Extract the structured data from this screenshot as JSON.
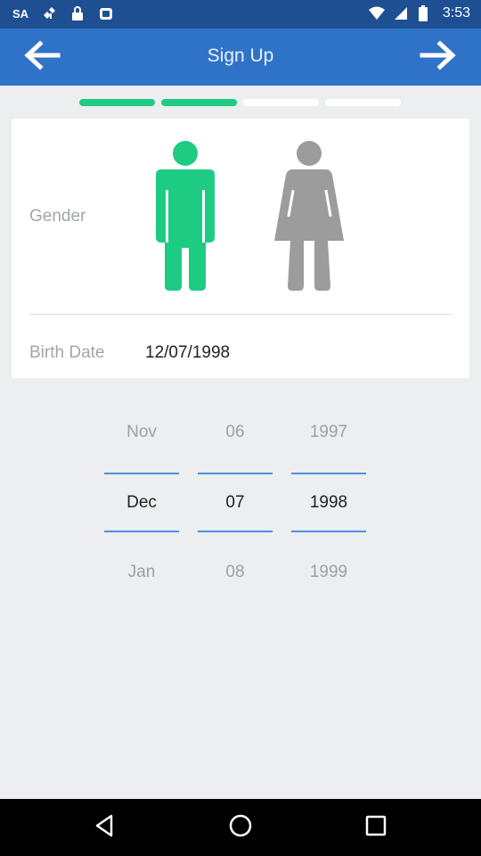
{
  "status_bar": {
    "carrier": "SA",
    "time": "3:53"
  },
  "header": {
    "title": "Sign Up",
    "back_icon": "arrow-left-icon",
    "next_icon": "arrow-right-icon"
  },
  "progress": {
    "total_steps": 4,
    "completed_steps": 2,
    "active_color": "#1ecb82",
    "inactive_color": "#ffffff"
  },
  "form": {
    "gender_label": "Gender",
    "selected_gender": "male",
    "male_color": "#1ecb82",
    "female_color": "#9c9c9c",
    "birth_date_label": "Birth Date",
    "birth_date_value": "12/07/1998"
  },
  "date_picker": {
    "month": {
      "prev": "Nov",
      "current": "Dec",
      "next": "Jan"
    },
    "day": {
      "prev": "06",
      "current": "07",
      "next": "08"
    },
    "year": {
      "prev": "1997",
      "current": "1998",
      "next": "1999"
    }
  },
  "colors": {
    "status_bar": "#1e4f92",
    "app_bar": "#2f73c8",
    "picker_line": "#4a90e2"
  }
}
